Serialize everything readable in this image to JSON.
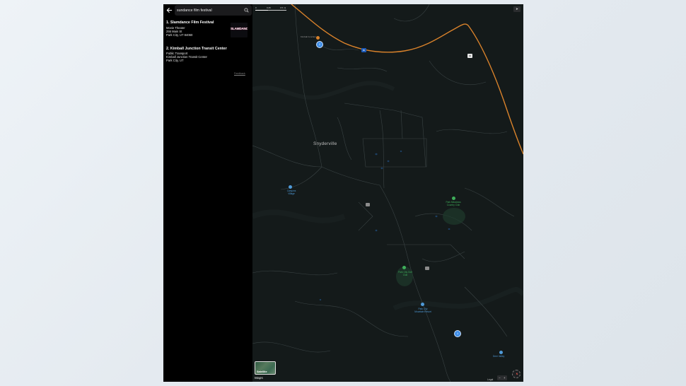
{
  "search": {
    "value": "sundance film festival"
  },
  "results": [
    {
      "title": "1. Slamdance Film Festival",
      "category": "Movie Theater",
      "address_line1": "255 Main St",
      "address_line2": "Park City, UT 84060",
      "thumbnail_text": "SLAMDANCE"
    },
    {
      "title": "2. Kimball Junction Transit Center",
      "category": "Public Transport",
      "address_line1": "Kimball Junction Transit Center",
      "address_line2": "Park City, UT"
    }
  ],
  "feedback_label": "Feedback",
  "map": {
    "scale": {
      "ticks": [
        "0",
        "0.25",
        "0.5 mi"
      ]
    },
    "labels": {
      "town": "Snyderville",
      "canyons_village": "Canyons Village",
      "park_meadows": "Park Meadows Country Club",
      "park_city_golf": "Park City Golf Club",
      "park_city_mountain": "Park City Mountain Resort",
      "deer_valley": "Deer Valley",
      "kimball": "Kimball Junction",
      "route_80": "80",
      "route_40": "40",
      "route_224": "224"
    },
    "pins": [
      "1",
      "2"
    ],
    "satellite_label": "Satellite",
    "brand_label": "Maps",
    "legal_label": "Legal",
    "zoom_out": "−",
    "zoom_in": "+",
    "compass_label": "N",
    "colors": {
      "background": "#141a1a",
      "highway": "#d9822b",
      "roads": "#3a4344",
      "pin": "#3f8ee8",
      "park": "#3fae5a"
    }
  }
}
